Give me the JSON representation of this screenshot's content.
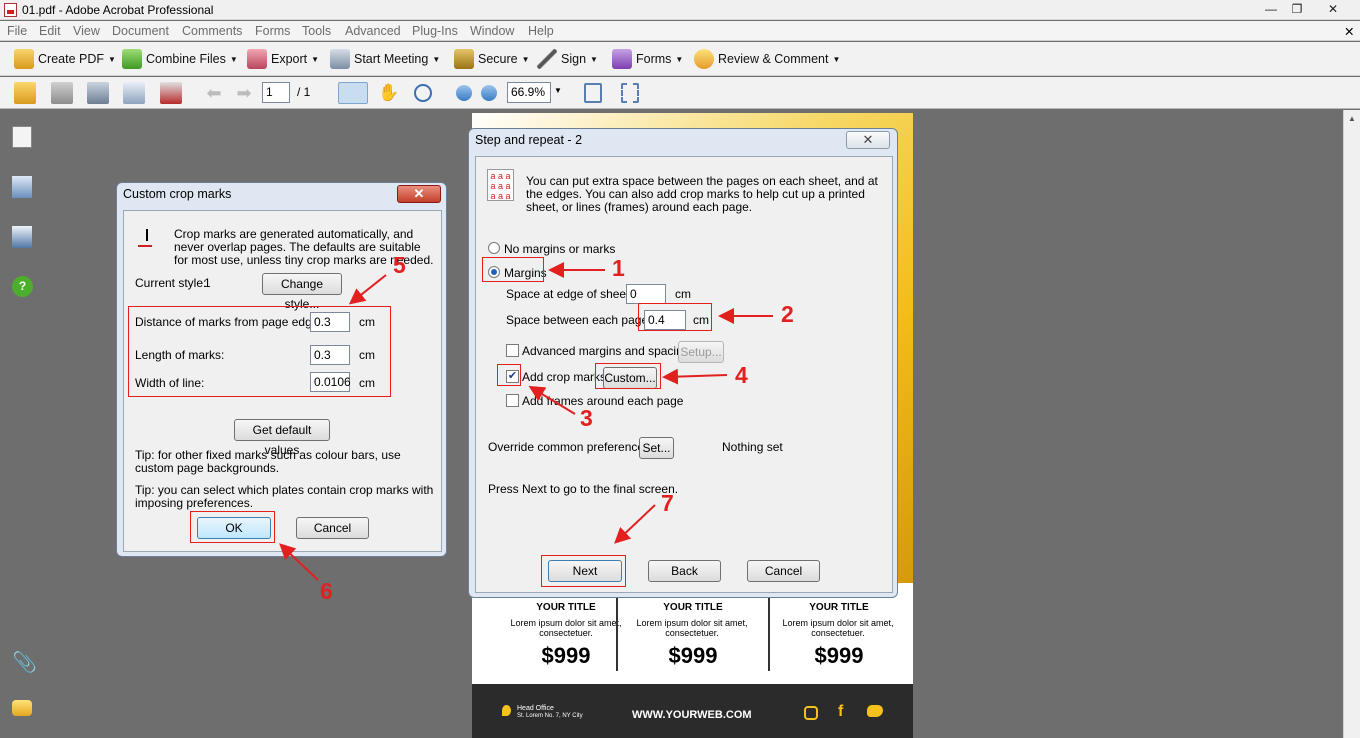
{
  "window": {
    "title": "01.pdf - Adobe Acrobat Professional",
    "min": "—",
    "max": "❐",
    "close": "✕",
    "doc_close": "✕"
  },
  "menu": [
    "File",
    "Edit",
    "View",
    "Document",
    "Comments",
    "Forms",
    "Tools",
    "Advanced",
    "Plug-Ins",
    "Window",
    "Help"
  ],
  "toolbar": {
    "create_pdf": "Create PDF",
    "combine_files": "Combine Files",
    "export": "Export",
    "start_meeting": "Start Meeting",
    "secure": "Secure",
    "sign": "Sign",
    "forms": "Forms",
    "review_comment": "Review & Comment"
  },
  "nav": {
    "page_current": "1",
    "page_total": "/ 1",
    "zoom": "66.9%"
  },
  "crop_dialog": {
    "title": "Custom crop marks",
    "close": "✕",
    "description": "Crop marks are generated automatically, and never overlap pages. The defaults are suitable for most use, unless tiny crop marks are needed.",
    "current_style_label": "Current style:",
    "current_style_value": "1",
    "change_style": "Change style...",
    "distance_label": "Distance of marks from page edge:",
    "distance_value": "0.3",
    "distance_unit": "cm",
    "length_label": "Length of marks:",
    "length_value": "0.3",
    "length_unit": "cm",
    "width_label": "Width of line:",
    "width_value": "0.0106",
    "width_unit": "cm",
    "defaults": "Get default values",
    "tip1": "Tip: for other fixed marks such as colour bars, use custom page backgrounds.",
    "tip2": "Tip: you can select which plates contain crop marks with imposing preferences.",
    "ok": "OK",
    "cancel": "Cancel"
  },
  "step_dialog": {
    "title": "Step and repeat - 2",
    "close": "✕",
    "description": "You can put extra space between the pages on each sheet, and at the edges. You can also add crop marks to help cut up a printed sheet, or lines (frames) around each page.",
    "no_margins": "No margins or marks",
    "margins": "Margins",
    "edge_label": "Space at edge of sheet:",
    "edge_value": "0",
    "edge_unit": "cm",
    "between_label": "Space between each page:",
    "between_value": "0.4",
    "between_unit": "cm",
    "advanced_label": "Advanced margins and spacing",
    "setup": "Setup...",
    "crop_label": "Add crop marks",
    "custom": "Custom...",
    "frames_label": "Add frames around each page",
    "override_label": "Override common preferences",
    "set": "Set...",
    "nothing_set": "Nothing set",
    "press_next": "Press Next to go to the final screen.",
    "next": "Next",
    "back": "Back",
    "cancel": "Cancel",
    "icon_letters": "a a a a a a a a a"
  },
  "annotations": [
    "1",
    "2",
    "3",
    "4",
    "5",
    "6",
    "7"
  ],
  "doc_page": {
    "cols": [
      {
        "title": "YOUR TITLE",
        "text": "Lorem ipsum dolor sit amet, consectetuer.",
        "price": "$999"
      },
      {
        "title": "YOUR TITLE",
        "text": "Lorem ipsum dolor sit amet, consectetuer.",
        "price": "$999"
      },
      {
        "title": "YOUR TITLE",
        "text": "Lorem ipsum dolor sit amet, consectetuer.",
        "price": "$999"
      }
    ],
    "office_title": "Head Office",
    "office_addr": "St. Lorem No. 7, NY City",
    "web": "WWW.YOURWEB.COM"
  },
  "colors": {
    "annotation": "#e32020",
    "accent_yellow": "#f5c21b",
    "footer": "#2b2b2b",
    "dialog_frame": "#dfe8f2"
  }
}
